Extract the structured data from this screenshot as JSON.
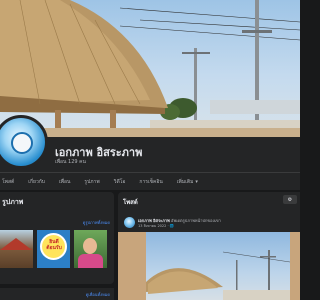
{
  "profile": {
    "name": "เอกภาพ อิสระภาพ",
    "followers": "เพื่อน 129 คน"
  },
  "tabs": [
    "โพสต์",
    "เกี่ยวกับ",
    "เพื่อน",
    "รูปภาพ",
    "วิดีโอ",
    "การเช็คอิน",
    "เพิ่มเติม"
  ],
  "left_card": {
    "title": "รูปภาพ",
    "see_all": "ดูรูปภาพทั้งหมด",
    "see_all_friends": "ดูเพื่อนทั้งหมด",
    "photo2_text": "ยินดีต้อนรับ"
  },
  "posts": {
    "title": "โพสต์",
    "filter_label": "⚙",
    "author": "เอกภาพ อิสระภาพ",
    "action": "อัพเดตรูปภาพหน้าปกของเขา",
    "date": "13 สิงหาคม 2022 · 🌐"
  },
  "colors": {
    "bg": "#18191a",
    "card": "#242526",
    "link": "#4c8ef7"
  }
}
